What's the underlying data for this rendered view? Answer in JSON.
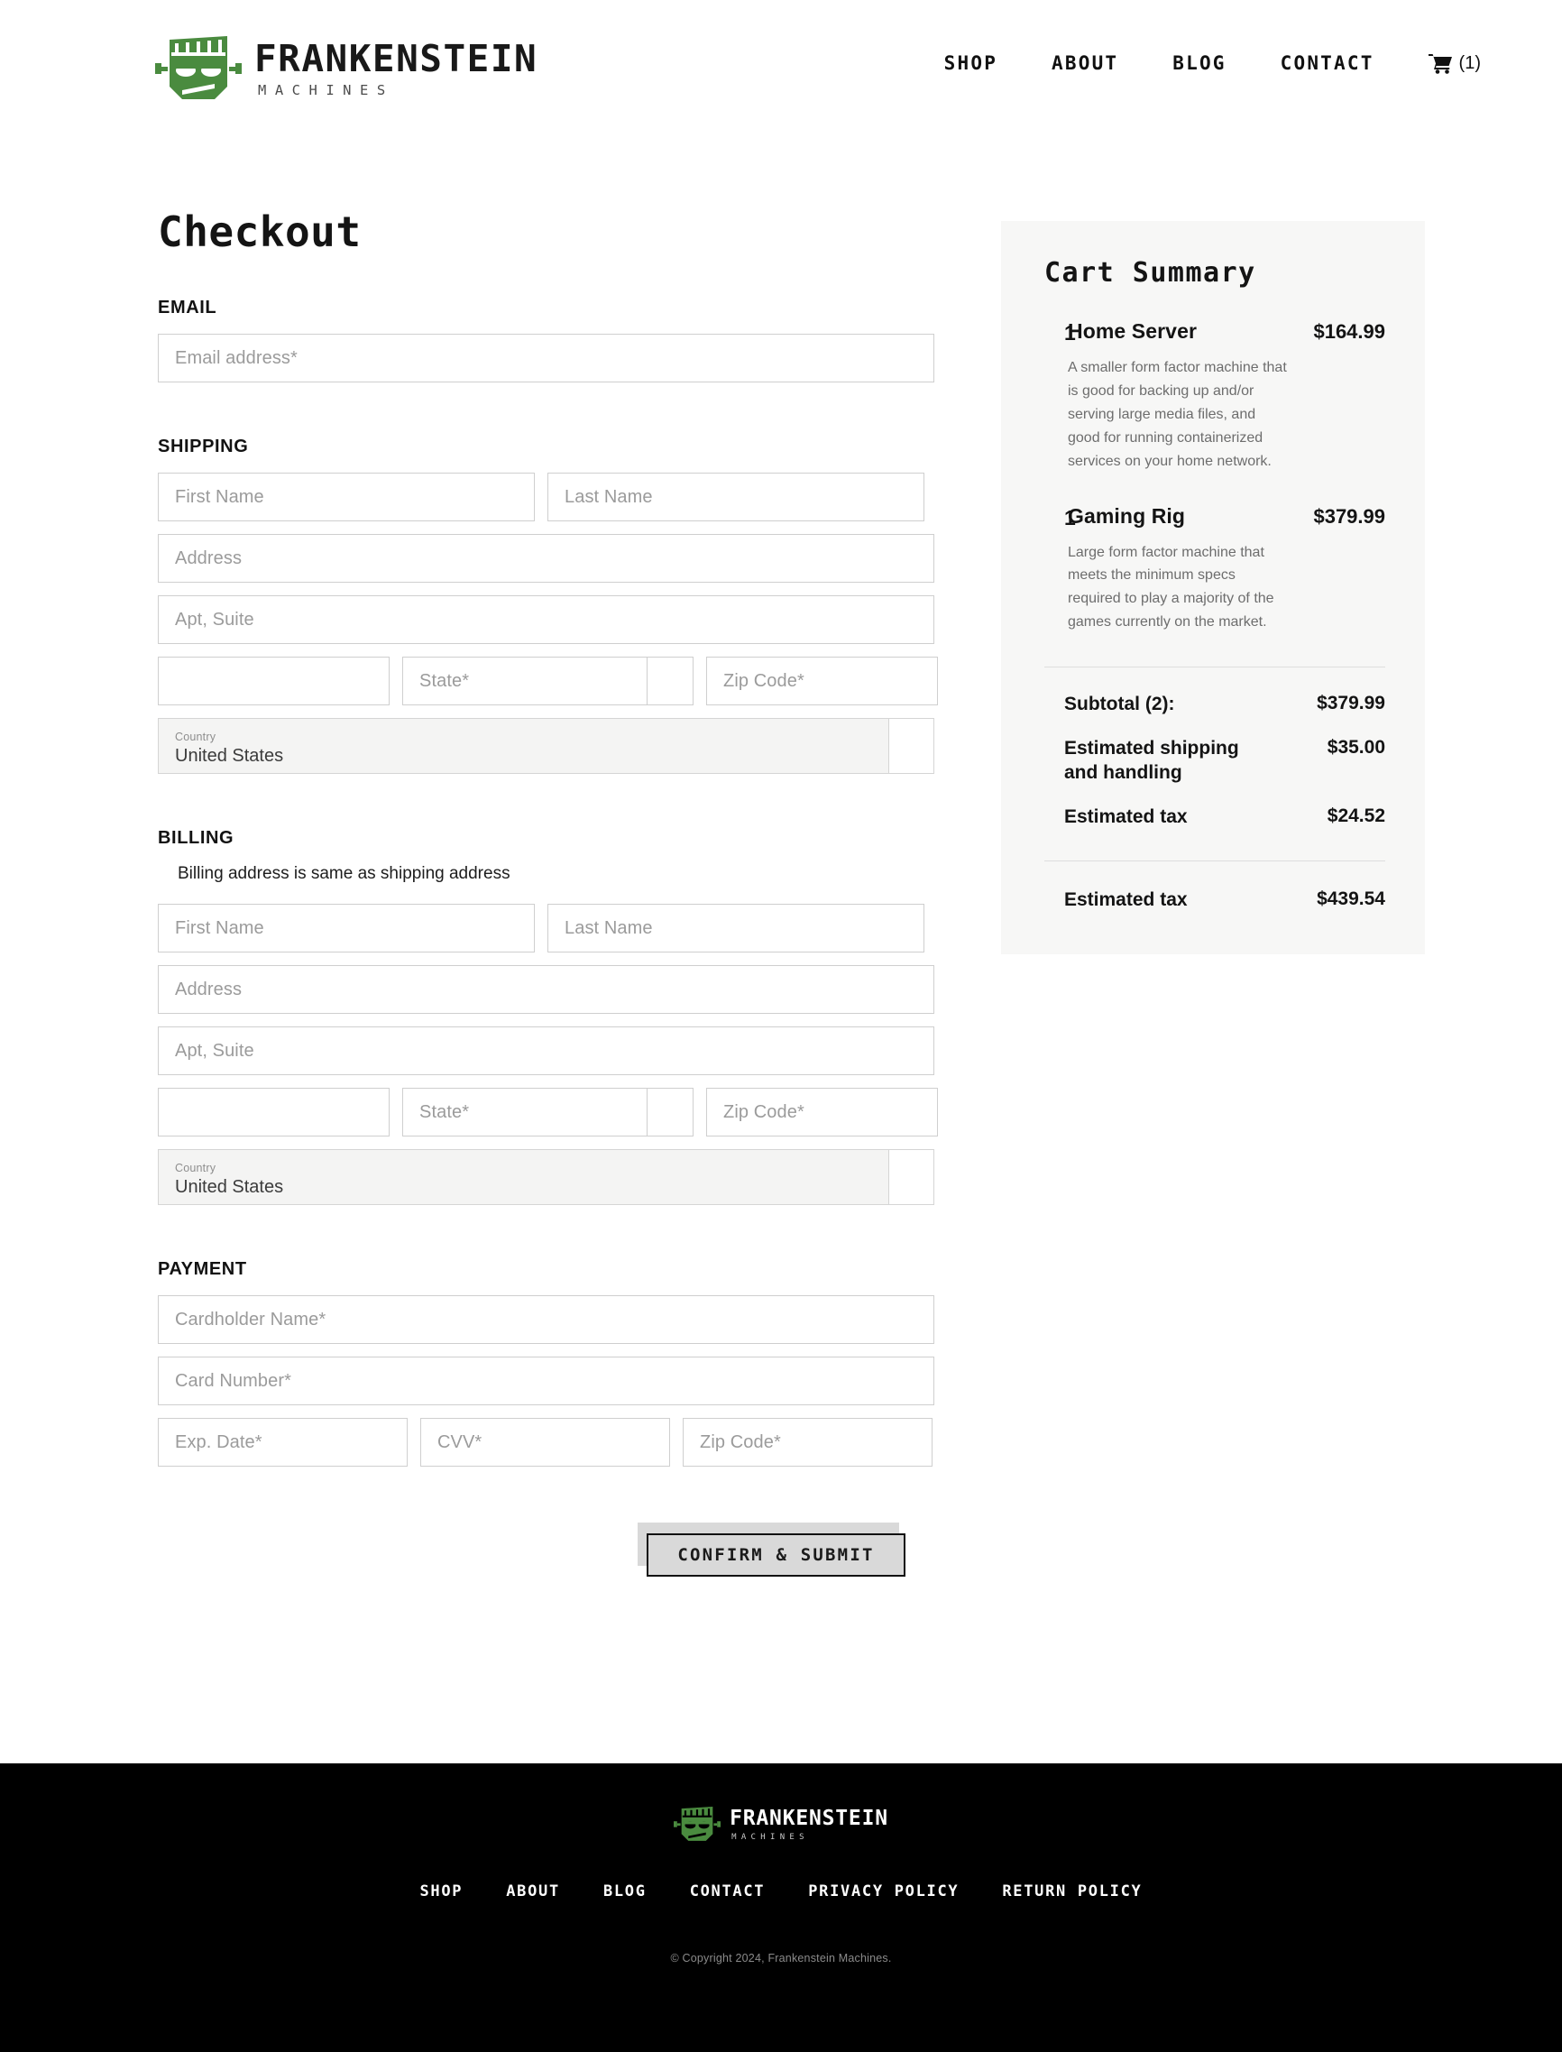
{
  "brand": {
    "name": "FRANKENSTEIN",
    "sub": "MACHINES",
    "logo_icon": "frankenstein-head-icon",
    "green": "#4a8b3f"
  },
  "header": {
    "nav": [
      {
        "label": "SHOP"
      },
      {
        "label": "ABOUT"
      },
      {
        "label": "BLOG"
      },
      {
        "label": "CONTACT"
      }
    ],
    "cart": {
      "icon": "shopping-cart-icon",
      "count": "(1)"
    }
  },
  "checkout": {
    "title": "Checkout",
    "email": {
      "section_label": "EMAIL",
      "email_placeholder": "Email address*"
    },
    "shipping": {
      "section_label": "SHIPPING",
      "first_name_placeholder": "First Name",
      "last_name_placeholder": "Last Name",
      "address_placeholder": "Address",
      "apt_placeholder": "Apt, Suite",
      "city_placeholder": "",
      "state_placeholder": "State*",
      "zip_placeholder": "Zip Code*",
      "country_label": "Country",
      "country_value": "United States"
    },
    "billing": {
      "section_label": "BILLING",
      "same_as_shipping_label": "Billing address is same as shipping address",
      "first_name_placeholder": "First Name",
      "last_name_placeholder": "Last Name",
      "address_placeholder": "Address",
      "apt_placeholder": "Apt, Suite",
      "city_placeholder": "",
      "state_placeholder": "State*",
      "zip_placeholder": "Zip Code*",
      "country_label": "Country",
      "country_value": "United States"
    },
    "payment": {
      "section_label": "PAYMENT",
      "cardholder_placeholder": "Cardholder Name*",
      "card_number_placeholder": "Card Number*",
      "exp_placeholder": "Exp. Date*",
      "cvv_placeholder": "CVV*",
      "zip_placeholder": "Zip Code*"
    },
    "submit_label": "CONFIRM & SUBMIT"
  },
  "summary": {
    "title": "Cart Summary",
    "items": [
      {
        "qty": "1",
        "name": "Home Server",
        "price": "$164.99",
        "desc": "A smaller form factor machine that is good for backing up and/or serving large media files, and good for running containerized services on your home network."
      },
      {
        "qty": "1",
        "name": "Gaming Rig",
        "price": "$379.99",
        "desc": "Large form factor machine that meets the minimum specs required to play a majority of the games currently on the market."
      }
    ],
    "totals": [
      {
        "label": "Subtotal (2):",
        "amount": "$379.99"
      },
      {
        "label": "Estimated shipping and handling",
        "amount": "$35.00"
      },
      {
        "label": "Estimated tax",
        "amount": "$24.52"
      }
    ],
    "grand": {
      "label": "Estimated tax",
      "amount": "$439.54"
    }
  },
  "footer": {
    "nav": [
      {
        "label": "SHOP"
      },
      {
        "label": "ABOUT"
      },
      {
        "label": "BLOG"
      },
      {
        "label": "CONTACT"
      },
      {
        "label": "PRIVACY POLICY"
      },
      {
        "label": "RETURN POLICY"
      }
    ],
    "copyright": "© Copyright 2024, Frankenstein Machines."
  }
}
